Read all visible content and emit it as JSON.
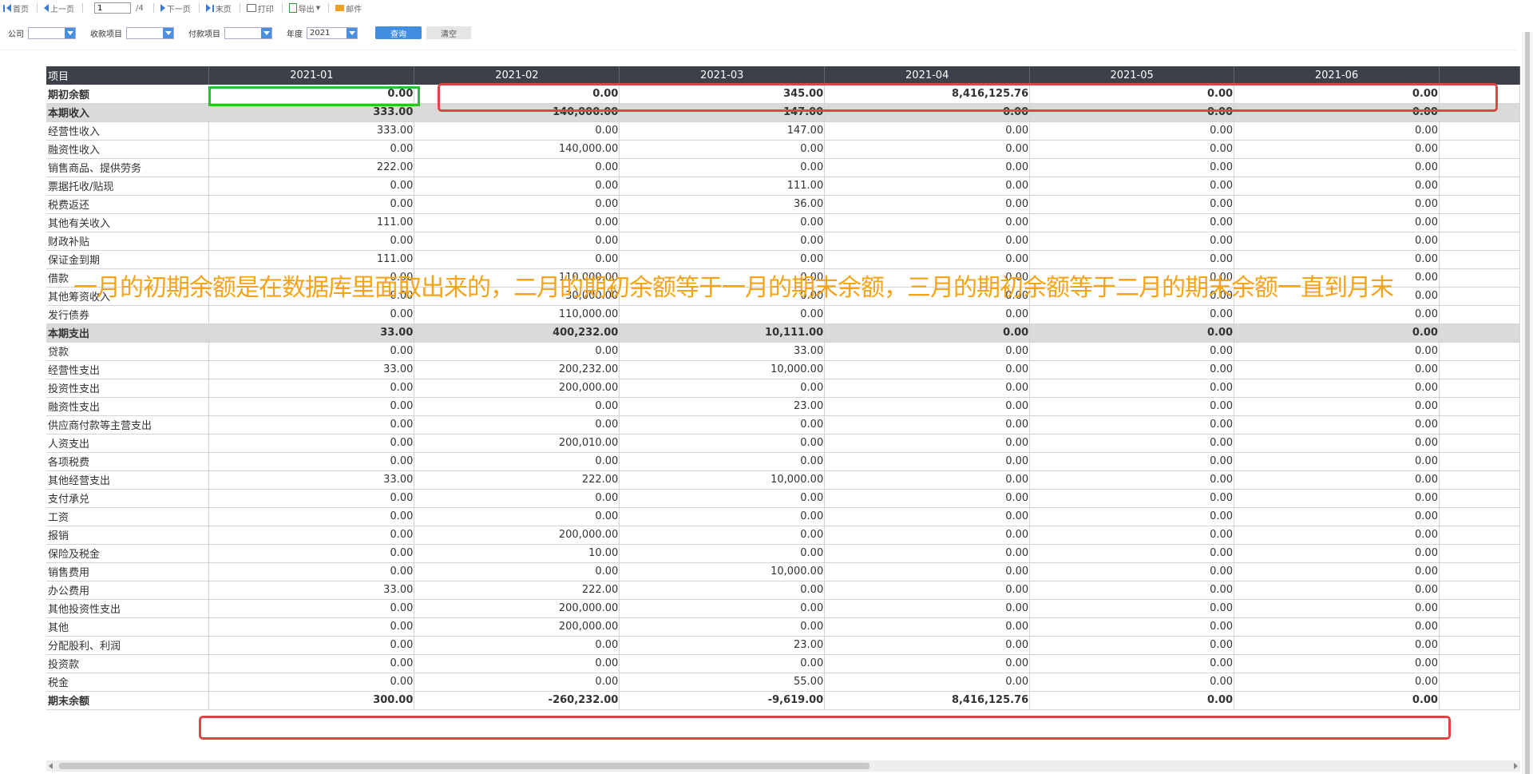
{
  "toolbar": {
    "first": "首页",
    "prev": "上一页",
    "page_value": "1",
    "page_total": "/4",
    "next": "下一页",
    "last": "末页",
    "print": "打印",
    "export": "导出",
    "mail": "邮件"
  },
  "filters": {
    "company_label": "公司",
    "receipt_label": "收款项目",
    "payment_label": "付款项目",
    "year_label": "年度",
    "year_value": "2021",
    "query_button": "查询",
    "clear_button": "清空"
  },
  "table": {
    "columns": [
      "项目",
      "2021-01",
      "2021-02",
      "2021-03",
      "2021-04",
      "2021-05",
      "2021-06"
    ],
    "rows": [
      {
        "name": "期初余额",
        "values": [
          "0.00",
          "0.00",
          "345.00",
          "8,416,125.76",
          "0.00",
          "0.00"
        ],
        "bold": true
      },
      {
        "name": "本期收入",
        "values": [
          "333.00",
          "140,000.00",
          "147.00",
          "0.00",
          "0.00",
          "0.00"
        ],
        "bold": true,
        "shaded": true
      },
      {
        "name": "经营性收入",
        "values": [
          "333.00",
          "0.00",
          "147.00",
          "0.00",
          "0.00",
          "0.00"
        ]
      },
      {
        "name": "融资性收入",
        "values": [
          "0.00",
          "140,000.00",
          "0.00",
          "0.00",
          "0.00",
          "0.00"
        ]
      },
      {
        "name": "销售商品、提供劳务",
        "values": [
          "222.00",
          "0.00",
          "0.00",
          "0.00",
          "0.00",
          "0.00"
        ]
      },
      {
        "name": "票据托收/贴现",
        "values": [
          "0.00",
          "0.00",
          "111.00",
          "0.00",
          "0.00",
          "0.00"
        ]
      },
      {
        "name": "税费返还",
        "values": [
          "0.00",
          "0.00",
          "36.00",
          "0.00",
          "0.00",
          "0.00"
        ]
      },
      {
        "name": "其他有关收入",
        "values": [
          "111.00",
          "0.00",
          "0.00",
          "0.00",
          "0.00",
          "0.00"
        ]
      },
      {
        "name": "财政补贴",
        "values": [
          "0.00",
          "0.00",
          "0.00",
          "0.00",
          "0.00",
          "0.00"
        ]
      },
      {
        "name": "保证金到期",
        "values": [
          "111.00",
          "0.00",
          "0.00",
          "0.00",
          "0.00",
          "0.00"
        ]
      },
      {
        "name": "借款",
        "values": [
          "0.00",
          "110,000.00",
          "0.00",
          "0.00",
          "0.00",
          "0.00"
        ]
      },
      {
        "name": "其他筹资收入",
        "values": [
          "0.00",
          "30,000.00",
          "0.00",
          "0.00",
          "0.00",
          "0.00"
        ]
      },
      {
        "name": "发行债券",
        "values": [
          "0.00",
          "110,000.00",
          "0.00",
          "0.00",
          "0.00",
          "0.00"
        ]
      },
      {
        "name": "本期支出",
        "values": [
          "33.00",
          "400,232.00",
          "10,111.00",
          "0.00",
          "0.00",
          "0.00"
        ],
        "bold": true,
        "shaded": true
      },
      {
        "name": "贷款",
        "values": [
          "0.00",
          "0.00",
          "33.00",
          "0.00",
          "0.00",
          "0.00"
        ]
      },
      {
        "name": "经营性支出",
        "values": [
          "33.00",
          "200,232.00",
          "10,000.00",
          "0.00",
          "0.00",
          "0.00"
        ]
      },
      {
        "name": "投资性支出",
        "values": [
          "0.00",
          "200,000.00",
          "0.00",
          "0.00",
          "0.00",
          "0.00"
        ]
      },
      {
        "name": "融资性支出",
        "values": [
          "0.00",
          "0.00",
          "23.00",
          "0.00",
          "0.00",
          "0.00"
        ]
      },
      {
        "name": "供应商付款等主营支出",
        "values": [
          "0.00",
          "0.00",
          "0.00",
          "0.00",
          "0.00",
          "0.00"
        ]
      },
      {
        "name": "人资支出",
        "values": [
          "0.00",
          "200,010.00",
          "0.00",
          "0.00",
          "0.00",
          "0.00"
        ]
      },
      {
        "name": "各项税费",
        "values": [
          "0.00",
          "0.00",
          "0.00",
          "0.00",
          "0.00",
          "0.00"
        ]
      },
      {
        "name": "其他经营支出",
        "values": [
          "33.00",
          "222.00",
          "10,000.00",
          "0.00",
          "0.00",
          "0.00"
        ]
      },
      {
        "name": "支付承兑",
        "values": [
          "0.00",
          "0.00",
          "0.00",
          "0.00",
          "0.00",
          "0.00"
        ]
      },
      {
        "name": "工资",
        "values": [
          "0.00",
          "0.00",
          "0.00",
          "0.00",
          "0.00",
          "0.00"
        ]
      },
      {
        "name": "报销",
        "values": [
          "0.00",
          "200,000.00",
          "0.00",
          "0.00",
          "0.00",
          "0.00"
        ]
      },
      {
        "name": "保险及税金",
        "values": [
          "0.00",
          "10.00",
          "0.00",
          "0.00",
          "0.00",
          "0.00"
        ]
      },
      {
        "name": "销售费用",
        "values": [
          "0.00",
          "0.00",
          "10,000.00",
          "0.00",
          "0.00",
          "0.00"
        ]
      },
      {
        "name": "办公费用",
        "values": [
          "33.00",
          "222.00",
          "0.00",
          "0.00",
          "0.00",
          "0.00"
        ]
      },
      {
        "name": "其他投资性支出",
        "values": [
          "0.00",
          "200,000.00",
          "0.00",
          "0.00",
          "0.00",
          "0.00"
        ]
      },
      {
        "name": "其他",
        "values": [
          "0.00",
          "200,000.00",
          "0.00",
          "0.00",
          "0.00",
          "0.00"
        ]
      },
      {
        "name": "分配股利、利润",
        "values": [
          "0.00",
          "0.00",
          "23.00",
          "0.00",
          "0.00",
          "0.00"
        ]
      },
      {
        "name": "投资款",
        "values": [
          "0.00",
          "0.00",
          "0.00",
          "0.00",
          "0.00",
          "0.00"
        ]
      },
      {
        "name": "税金",
        "values": [
          "0.00",
          "0.00",
          "55.00",
          "0.00",
          "0.00",
          "0.00"
        ]
      },
      {
        "name": "期末余额",
        "values": [
          "300.00",
          "-260,232.00",
          "-9,619.00",
          "8,416,125.76",
          "0.00",
          "0.00"
        ],
        "bold": true
      }
    ]
  },
  "annotation": "一月的初期余额是在数据库里面取出来的，二月的期初余额等于一月的期末余额，三月的期初余额等于二月的期末余额一直到月末",
  "colors": {
    "header_bg": "#3c4049",
    "highlight_green": "#2ec02b",
    "highlight_red": "#e24444",
    "annotation": "#f5a318",
    "query_button": "#3f8ee2"
  }
}
